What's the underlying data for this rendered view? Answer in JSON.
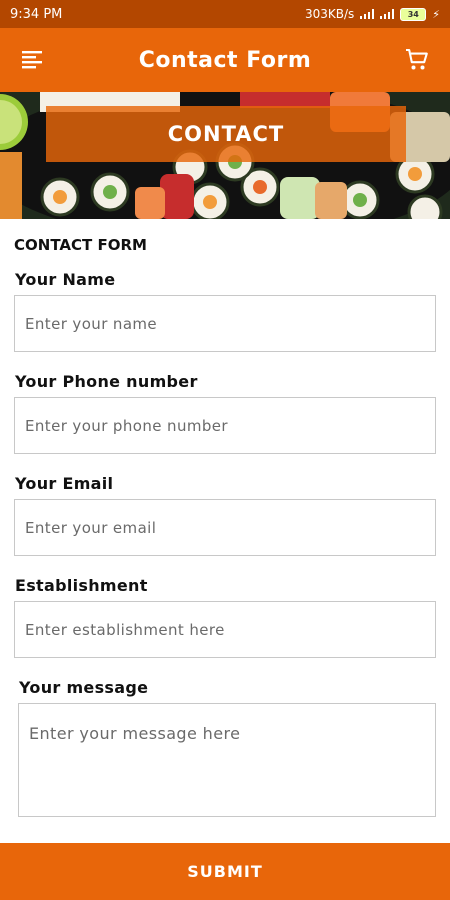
{
  "status_bar": {
    "time": "9:34 PM",
    "network_speed": "303KB/s",
    "battery_level": "34"
  },
  "app_bar": {
    "title": "Contact Form",
    "menu_icon": "menu-icon",
    "cart_icon": "cart-icon",
    "background_color": "#e8660a"
  },
  "hero": {
    "banner_text": "CONTACT"
  },
  "form": {
    "section_title": "CONTACT FORM",
    "fields": [
      {
        "label": "Your Name",
        "placeholder": "Enter your name",
        "value": ""
      },
      {
        "label": "Your Phone number",
        "placeholder": "Enter your phone number",
        "value": ""
      },
      {
        "label": "Your Email",
        "placeholder": "Enter your email",
        "value": ""
      },
      {
        "label": "Establishment",
        "placeholder": "Enter establishment here",
        "value": ""
      }
    ],
    "message": {
      "label": "Your message",
      "placeholder": "Enter your message here",
      "value": ""
    },
    "submit_label": "SUBMIT"
  }
}
